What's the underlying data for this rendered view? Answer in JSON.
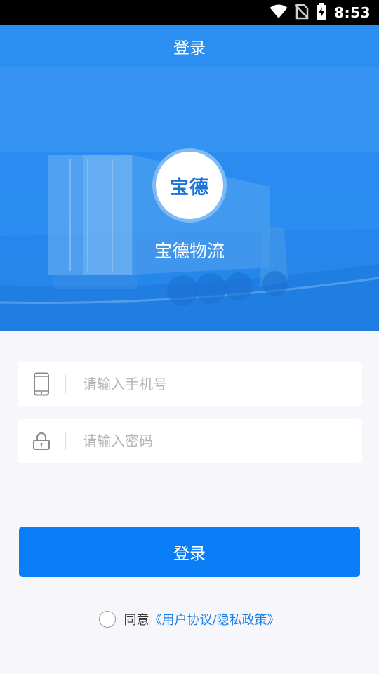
{
  "status_bar": {
    "time": "8:53",
    "icons": [
      "wifi-icon",
      "no-sim-icon",
      "battery-charging-icon"
    ]
  },
  "header": {
    "title": "登录"
  },
  "brand": {
    "logo_text": "宝德",
    "name": "宝德物流"
  },
  "form": {
    "phone": {
      "placeholder": "请输入手机号",
      "value": "",
      "icon": "mobile-phone-icon"
    },
    "password": {
      "placeholder": "请输入密码",
      "value": "",
      "icon": "lock-icon"
    },
    "login_label": "登录"
  },
  "agreement": {
    "checked": false,
    "prefix": "同意",
    "link_text": "《用户协议/隐私政策》"
  },
  "colors": {
    "primary": "#0a7ef7",
    "hero": "#2a8cf0",
    "link": "#1b7fe6",
    "page_bg": "#f7f7fb"
  }
}
